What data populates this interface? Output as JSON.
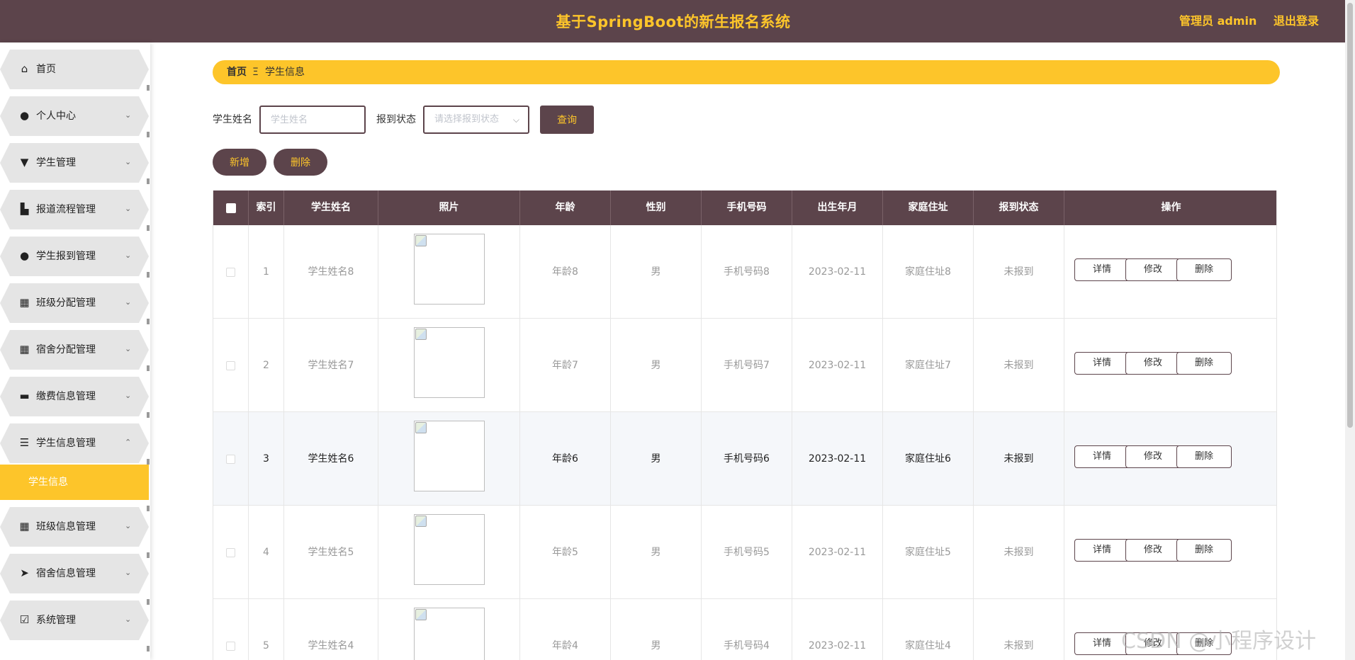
{
  "header": {
    "title": "基于SpringBoot的新生报名系统",
    "user_label": "管理员 admin",
    "logout_label": "退出登录"
  },
  "sidebar": {
    "items": [
      {
        "label": "首页",
        "icon": "home-icon"
      },
      {
        "label": "个人中心",
        "icon": "user-icon"
      },
      {
        "label": "学生管理",
        "icon": "stamp-icon"
      },
      {
        "label": "报道流程管理",
        "icon": "flow-icon"
      },
      {
        "label": "学生报到管理",
        "icon": "user-check-icon"
      },
      {
        "label": "班级分配管理",
        "icon": "grid-icon"
      },
      {
        "label": "宿舍分配管理",
        "icon": "grid-icon"
      },
      {
        "label": "缴费信息管理",
        "icon": "monitor-icon"
      },
      {
        "label": "学生信息管理",
        "icon": "sliders-icon"
      },
      {
        "label": "班级信息管理",
        "icon": "grid-icon"
      },
      {
        "label": "宿舍信息管理",
        "icon": "send-icon"
      },
      {
        "label": "系统管理",
        "icon": "clipboard-icon"
      }
    ],
    "active_sub": "学生信息"
  },
  "breadcrumb": {
    "home": "首页",
    "separator": "Ξ",
    "current": "学生信息"
  },
  "search": {
    "name_label": "学生姓名",
    "name_placeholder": "学生姓名",
    "status_label": "报到状态",
    "status_placeholder": "请选择报到状态",
    "query_button": "查询"
  },
  "actions": {
    "add_button": "新增",
    "delete_button": "删除"
  },
  "table": {
    "columns": [
      "索引",
      "学生姓名",
      "照片",
      "年龄",
      "性别",
      "手机号码",
      "出生年月",
      "家庭住址",
      "报到状态",
      "操作"
    ],
    "rows": [
      {
        "index": "1",
        "name": "学生姓名8",
        "age": "年龄8",
        "gender": "男",
        "phone": "手机号码8",
        "birth": "2023-02-11",
        "address": "家庭住址8",
        "status": "未报到"
      },
      {
        "index": "2",
        "name": "学生姓名7",
        "age": "年龄7",
        "gender": "男",
        "phone": "手机号码7",
        "birth": "2023-02-11",
        "address": "家庭住址7",
        "status": "未报到"
      },
      {
        "index": "3",
        "name": "学生姓名6",
        "age": "年龄6",
        "gender": "男",
        "phone": "手机号码6",
        "birth": "2023-02-11",
        "address": "家庭住址6",
        "status": "未报到"
      },
      {
        "index": "4",
        "name": "学生姓名5",
        "age": "年龄5",
        "gender": "男",
        "phone": "手机号码5",
        "birth": "2023-02-11",
        "address": "家庭住址5",
        "status": "未报到"
      },
      {
        "index": "5",
        "name": "学生姓名4",
        "age": "年龄4",
        "gender": "男",
        "phone": "手机号码4",
        "birth": "2023-02-11",
        "address": "家庭住址4",
        "status": "未报到"
      }
    ],
    "highlighted_row": 2,
    "row_actions": [
      "详情",
      "修改",
      "删除"
    ]
  },
  "colors": {
    "primary": "#5c444b",
    "accent": "#fdc52a"
  },
  "watermark": "CSDN @小程序设计"
}
